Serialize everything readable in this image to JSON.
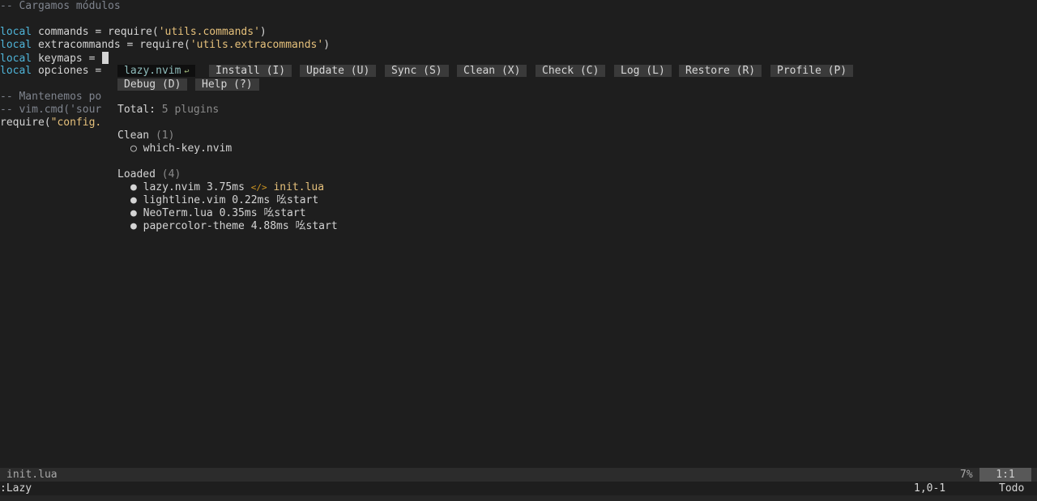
{
  "editor": {
    "lines": [
      {
        "comment": "-- Cargamos módulos"
      },
      {
        "blank": ""
      },
      {
        "kw": "local",
        "name": " commands = require(",
        "str": "'utils.commands'",
        "tail": ")"
      },
      {
        "kw": "local",
        "name": " extracommands = require(",
        "str": "'utils.extracommands'",
        "tail": ")"
      },
      {
        "kw": "local",
        "name": " keymaps = ",
        "str": "",
        "tail": ""
      },
      {
        "kw": "local",
        "name": " opciones = ",
        "str": "",
        "tail": ""
      },
      {
        "blank": ""
      },
      {
        "comment": "-- Mantenemos po"
      },
      {
        "comment": "-- vim.cmd('sour"
      },
      {
        "plain": "require(",
        "str": "\"config.",
        "tail": ""
      }
    ]
  },
  "lazy": {
    "tabs": [
      {
        "label": "lazy.nvim",
        "icon": "↩",
        "active": true
      },
      {
        "label": "Install (I)"
      },
      {
        "label": "Update (U)"
      },
      {
        "label": "Sync (S)"
      },
      {
        "label": "Clean (X)"
      },
      {
        "label": "Check (C)"
      },
      {
        "label": "Log (L)"
      },
      {
        "label": "Restore (R)"
      },
      {
        "label": "Profile (P)"
      },
      {
        "label": "Debug (D)"
      },
      {
        "label": "Help (?)"
      }
    ],
    "total_label": "Total:",
    "total_value": "5 plugins",
    "clean": {
      "label": "Clean",
      "count": "(1)",
      "items": [
        {
          "bullet": "○",
          "name": "which-key.nvim"
        }
      ]
    },
    "loaded": {
      "label": "Loaded",
      "count": "(4)",
      "items": [
        {
          "bullet": "●",
          "name": "lazy.nvim",
          "time": "3.75ms",
          "icon": "</>",
          "source": "init.lua"
        },
        {
          "bullet": "●",
          "name": "lightline.vim",
          "time": "0.22ms",
          "icon": "吆",
          "source": "start"
        },
        {
          "bullet": "●",
          "name": "NeoTerm.lua",
          "time": "0.35ms",
          "icon": "吆",
          "source": "start"
        },
        {
          "bullet": "●",
          "name": "papercolor-theme",
          "time": "4.88ms",
          "icon": "吆",
          "source": "start"
        }
      ]
    }
  },
  "statusline": {
    "file": "init.lua",
    "percent": "7%",
    "position": "1:1"
  },
  "cmdline": {
    "text": ":Lazy",
    "ruler": "1,0-1",
    "mode": "Todo"
  }
}
